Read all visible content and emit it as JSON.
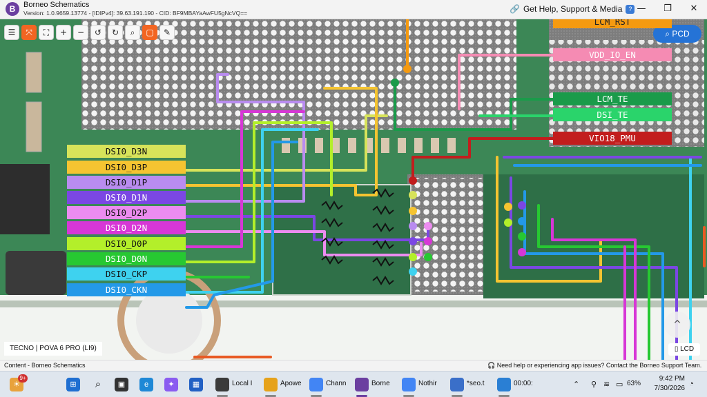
{
  "window": {
    "title": "Borneo Schematics",
    "version_line": "Version: 1.0.9659.13774 - [IDIPv4]: 39.63.191.190 - CID: BF9MBAYaAwFU5gNcVQ==",
    "help_link": "Get Help, Support & Media",
    "help_badge": "?",
    "minimize": "—",
    "maximize": "❐",
    "close": "✕"
  },
  "toolbar": {
    "list_icon": "☰",
    "fit_icon": "⤧",
    "fullscreen_icon": "⛶",
    "zoom_in_icon": "+",
    "zoom_out_icon": "−",
    "rotate_left_icon": "↺",
    "rotate_right_icon": "↻",
    "search_icon": "⌕",
    "mouse_icon": "▢",
    "highlight_icon": "✎"
  },
  "pcd_button": {
    "icon": "⌕",
    "label": "PCD"
  },
  "left_labels": [
    {
      "text": "DSI0_D3N",
      "color": "#d7e35a"
    },
    {
      "text": "DSI0_D3P",
      "color": "#f5c431"
    },
    {
      "text": "DSI0_D1P",
      "color": "#b98cf0"
    },
    {
      "text": "DSI0_D1N",
      "color": "#7b47e3"
    },
    {
      "text": "DSI0_D2P",
      "color": "#ec8cf0"
    },
    {
      "text": "DSI0_D2N",
      "color": "#d737d6"
    },
    {
      "text": "DSI0_D0P",
      "color": "#b3ef2a"
    },
    {
      "text": "DSI0_D0N",
      "color": "#27c832"
    },
    {
      "text": "DSI0_CKP",
      "color": "#3ed2ef"
    },
    {
      "text": "DSI0_CKN",
      "color": "#2399e8"
    }
  ],
  "right_labels": [
    {
      "text": "LCM_RST",
      "color": "#f59a10",
      "text_color": "#222"
    },
    {
      "text": "VDD_IO_EN",
      "color": "#f58bb3",
      "text_color": "#ffffff"
    },
    {
      "text": "LCM_TE",
      "color": "#1a9b4a",
      "text_color": "#ffffff"
    },
    {
      "text": "DSI_TE",
      "color": "#2ad46b",
      "text_color": "#ffffff"
    },
    {
      "text": "VIO18_PMU",
      "color": "#c21d1d",
      "text_color": "#ffffff"
    }
  ],
  "board_name": "TECNO | POVA 6 PRO (LI9)",
  "lcd_tag": "LCD",
  "scroll_up_icon": "^",
  "status": {
    "left": "Content - Borneo Schematics",
    "right": "Need help or experiencing app issues? Contact the Borneo Support Team."
  },
  "taskbar": {
    "weather_badge": "9+",
    "start_icon": "⊞",
    "search_icon": "⌕",
    "apps": [
      {
        "name": "Local I",
        "color": "#3a3a3a"
      },
      {
        "name": "Apowe",
        "color": "#e6a21a"
      },
      {
        "name": "Chann",
        "color": "#4285f4"
      },
      {
        "name": "Borne",
        "color": "#6b3fa0"
      },
      {
        "name": "Nothir",
        "color": "#4285f4"
      },
      {
        "name": "*seo.t",
        "color": "#3a6fc9"
      },
      {
        "name": "00:00:",
        "color": "#2a7fd4"
      }
    ],
    "battery": "63%",
    "time": "9:42 PM",
    "date": "7/30/2026"
  }
}
